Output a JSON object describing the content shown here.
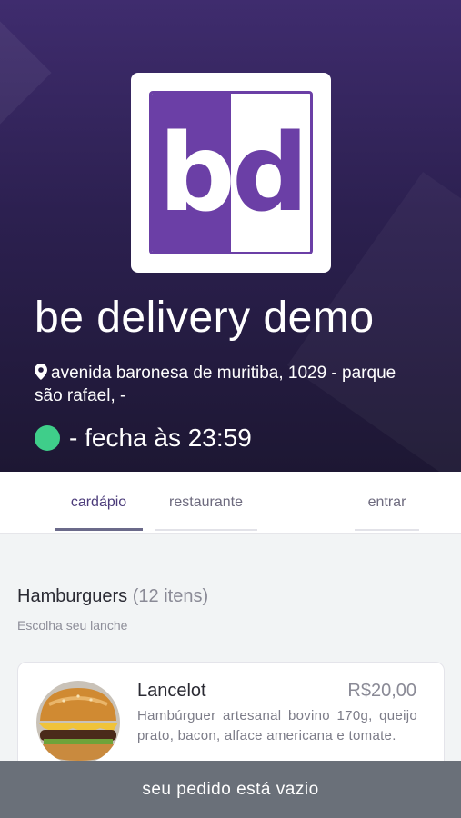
{
  "header": {
    "logo_letters": "bd",
    "store_name": "be delivery demo",
    "address": "avenida baronesa de muritiba, 1029 - parque são rafael, -",
    "status_text": "- fecha às 23:59",
    "brand_color": "#6b3fa6",
    "status_color": "#3fce8a"
  },
  "tabs": [
    {
      "label": "cardápio",
      "active": true
    },
    {
      "label": "restaurante",
      "active": false
    },
    {
      "label": "entrar",
      "active": false
    }
  ],
  "section": {
    "title": "Hamburguers",
    "count": "(12 itens)",
    "subtitle": "Escolha seu lanche"
  },
  "items": [
    {
      "name": "Lancelot",
      "price": "R$20,00",
      "description": "Hambúrguer artesanal bovino 170g, queijo prato, bacon, alface americana e tomate."
    }
  ],
  "cart": {
    "label": "seu pedido está vazio"
  }
}
